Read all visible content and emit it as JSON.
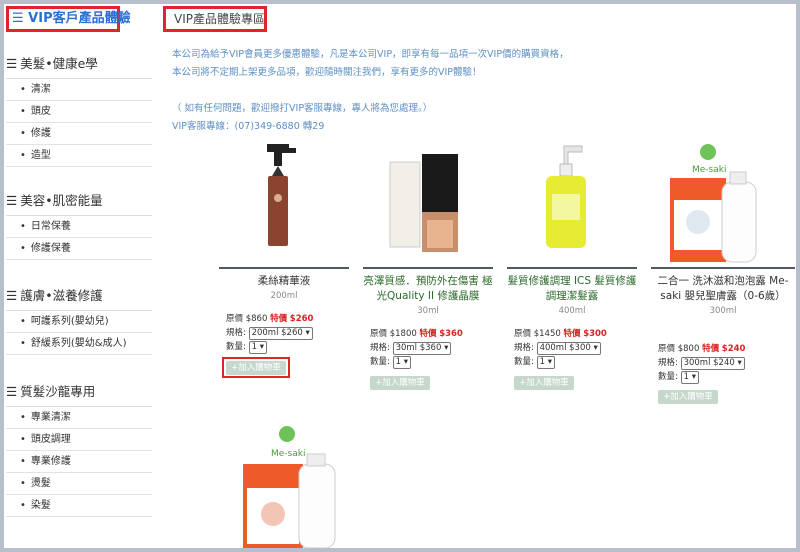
{
  "sidebar": {
    "title": "☰ VIP客戶產品體驗",
    "groups": [
      {
        "label": "美髮•健康e學",
        "items": [
          "清潔",
          "頭皮",
          "修護",
          "造型"
        ]
      },
      {
        "label": "美容•肌密能量",
        "items": [
          "日常保養",
          "修護保養"
        ]
      },
      {
        "label": "護膚•滋養修護",
        "items": [
          "呵護系列(嬰幼兒)",
          "舒緩系列(嬰幼&成人)"
        ]
      },
      {
        "label": "質髮沙龍專用",
        "items": [
          "專業清潔",
          "頭皮調理",
          "專業修護",
          "燙髮",
          "染髮"
        ]
      }
    ]
  },
  "main": {
    "title": "VIP產品體驗專區",
    "intro": [
      "本公司為給予VIP會員更多優惠體驗，凡是本公司VIP，即享有每一品項一次VIP價的購買資格，",
      "本公司將不定期上架更多品項，歡迎隨時關注我們，享有更多的VIP體驗！",
      "",
      "（ 如有任何問題，歡迎撥打VIP客服專線，專人將為您處理。）",
      "VIP客服專線：(07)349-6880 轉29"
    ]
  },
  "products": [
    {
      "name": "柔絲精華液",
      "size": "200ml",
      "price_label": "原價",
      "price": "$860",
      "sale_label": "特價",
      "sale": "$260",
      "spec_label": "規格:",
      "spec": "200ml  $260",
      "qty_label": "數量:",
      "qty": "1",
      "button": "+加入購物車"
    },
    {
      "name": "亮澤質感．預防外在傷害 極光Quality II 修護晶膜",
      "size": "30ml",
      "price_label": "原價",
      "price": "$1800",
      "sale_label": "特價",
      "sale": "$360",
      "spec_label": "規格:",
      "spec": "30ml    $360",
      "qty_label": "數量:",
      "qty": "1",
      "button": "+加入購物車"
    },
    {
      "name": "髮質修護調理 ICS 髮質修護調理潔髮露",
      "size": "400ml",
      "price_label": "原價",
      "price": "$1450",
      "sale_label": "特價",
      "sale": "$300",
      "spec_label": "規格:",
      "spec": "400ml    $300",
      "qty_label": "數量:",
      "qty": "1",
      "button": "+加入購物車"
    },
    {
      "name": "二合一 洗沐滋和泡泡露 Me-saki 嬰兒聖膚露（0-6歲）",
      "size": "300ml",
      "price_label": "原價",
      "price": "$800",
      "sale_label": "特價",
      "sale": "$240",
      "spec_label": "規格:",
      "spec": "300ml  $240",
      "qty_label": "數量:",
      "qty": "1",
      "button": "+加入購物車"
    }
  ],
  "brand": {
    "logo_text": "Me-saki",
    "box_text": "Me-saki"
  },
  "colors": {
    "accent_blue": "#2a6fd6",
    "highlight_red": "#e0242a",
    "sale_red": "#d22222",
    "button_green": "#c6d8cc"
  }
}
